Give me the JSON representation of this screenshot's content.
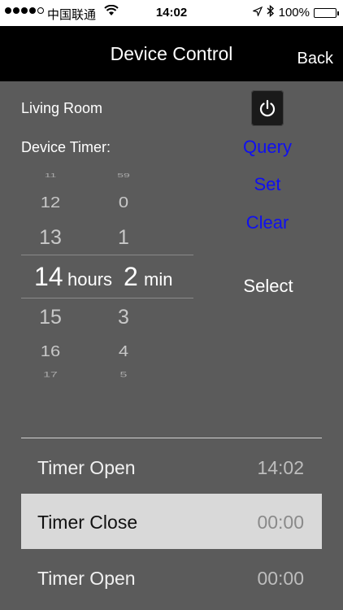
{
  "status_bar": {
    "carrier": "中国联通",
    "time": "14:02",
    "battery": "100%"
  },
  "nav": {
    "title": "Device Control",
    "back": "Back"
  },
  "room": "Living Room",
  "timer_label": "Device Timer:",
  "actions": {
    "query": "Query",
    "set": "Set",
    "clear": "Clear",
    "select": "Select"
  },
  "picker": {
    "hours": [
      "11",
      "12",
      "13",
      "14",
      "15",
      "16",
      "17"
    ],
    "minutes": [
      "59",
      "0",
      "1",
      "2",
      "3",
      "4",
      "5"
    ],
    "selected_hour": "14",
    "hours_unit": "hours",
    "selected_minute": "2",
    "min_unit": "min"
  },
  "timers": [
    {
      "name": "Timer Open",
      "time": "14:02"
    },
    {
      "name": "Timer Close",
      "time": "00:00"
    },
    {
      "name": "Timer Open",
      "time": "00:00"
    }
  ]
}
